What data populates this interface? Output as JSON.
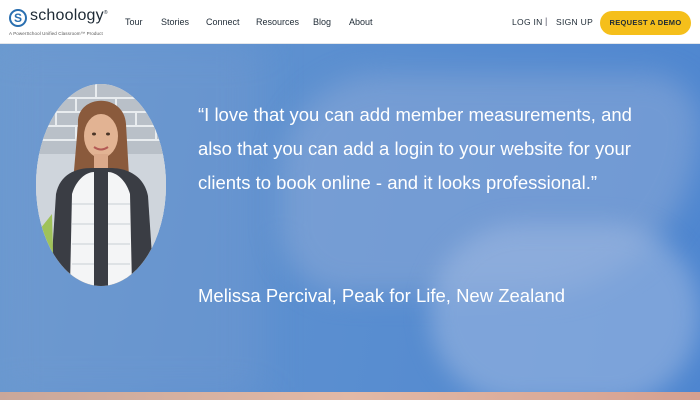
{
  "brand": {
    "letter": "S",
    "name": "schoology",
    "tagline": "A PowerSchool Unified Classroom™ Product"
  },
  "nav": {
    "items": [
      {
        "label": "Tour"
      },
      {
        "label": "Stories"
      },
      {
        "label": "Connect"
      },
      {
        "label": "Resources"
      },
      {
        "label": "Blog"
      },
      {
        "label": "About"
      }
    ]
  },
  "auth": {
    "login": "LOG IN",
    "separator": "|",
    "signup": "SIGN UP"
  },
  "cta": {
    "label": "REQUEST A DEMO"
  },
  "testimonial": {
    "quote": "“I love that you can add member measurements, and also that you can add a login to your website for your clients to book online - and it looks professional.”",
    "author": "Melissa Percival, Peak for Life, New Zealand"
  },
  "colors": {
    "brand_blue": "#2a6fb0",
    "cta_yellow": "#f5bf1b",
    "hero_blue": "#5b8fd0"
  }
}
